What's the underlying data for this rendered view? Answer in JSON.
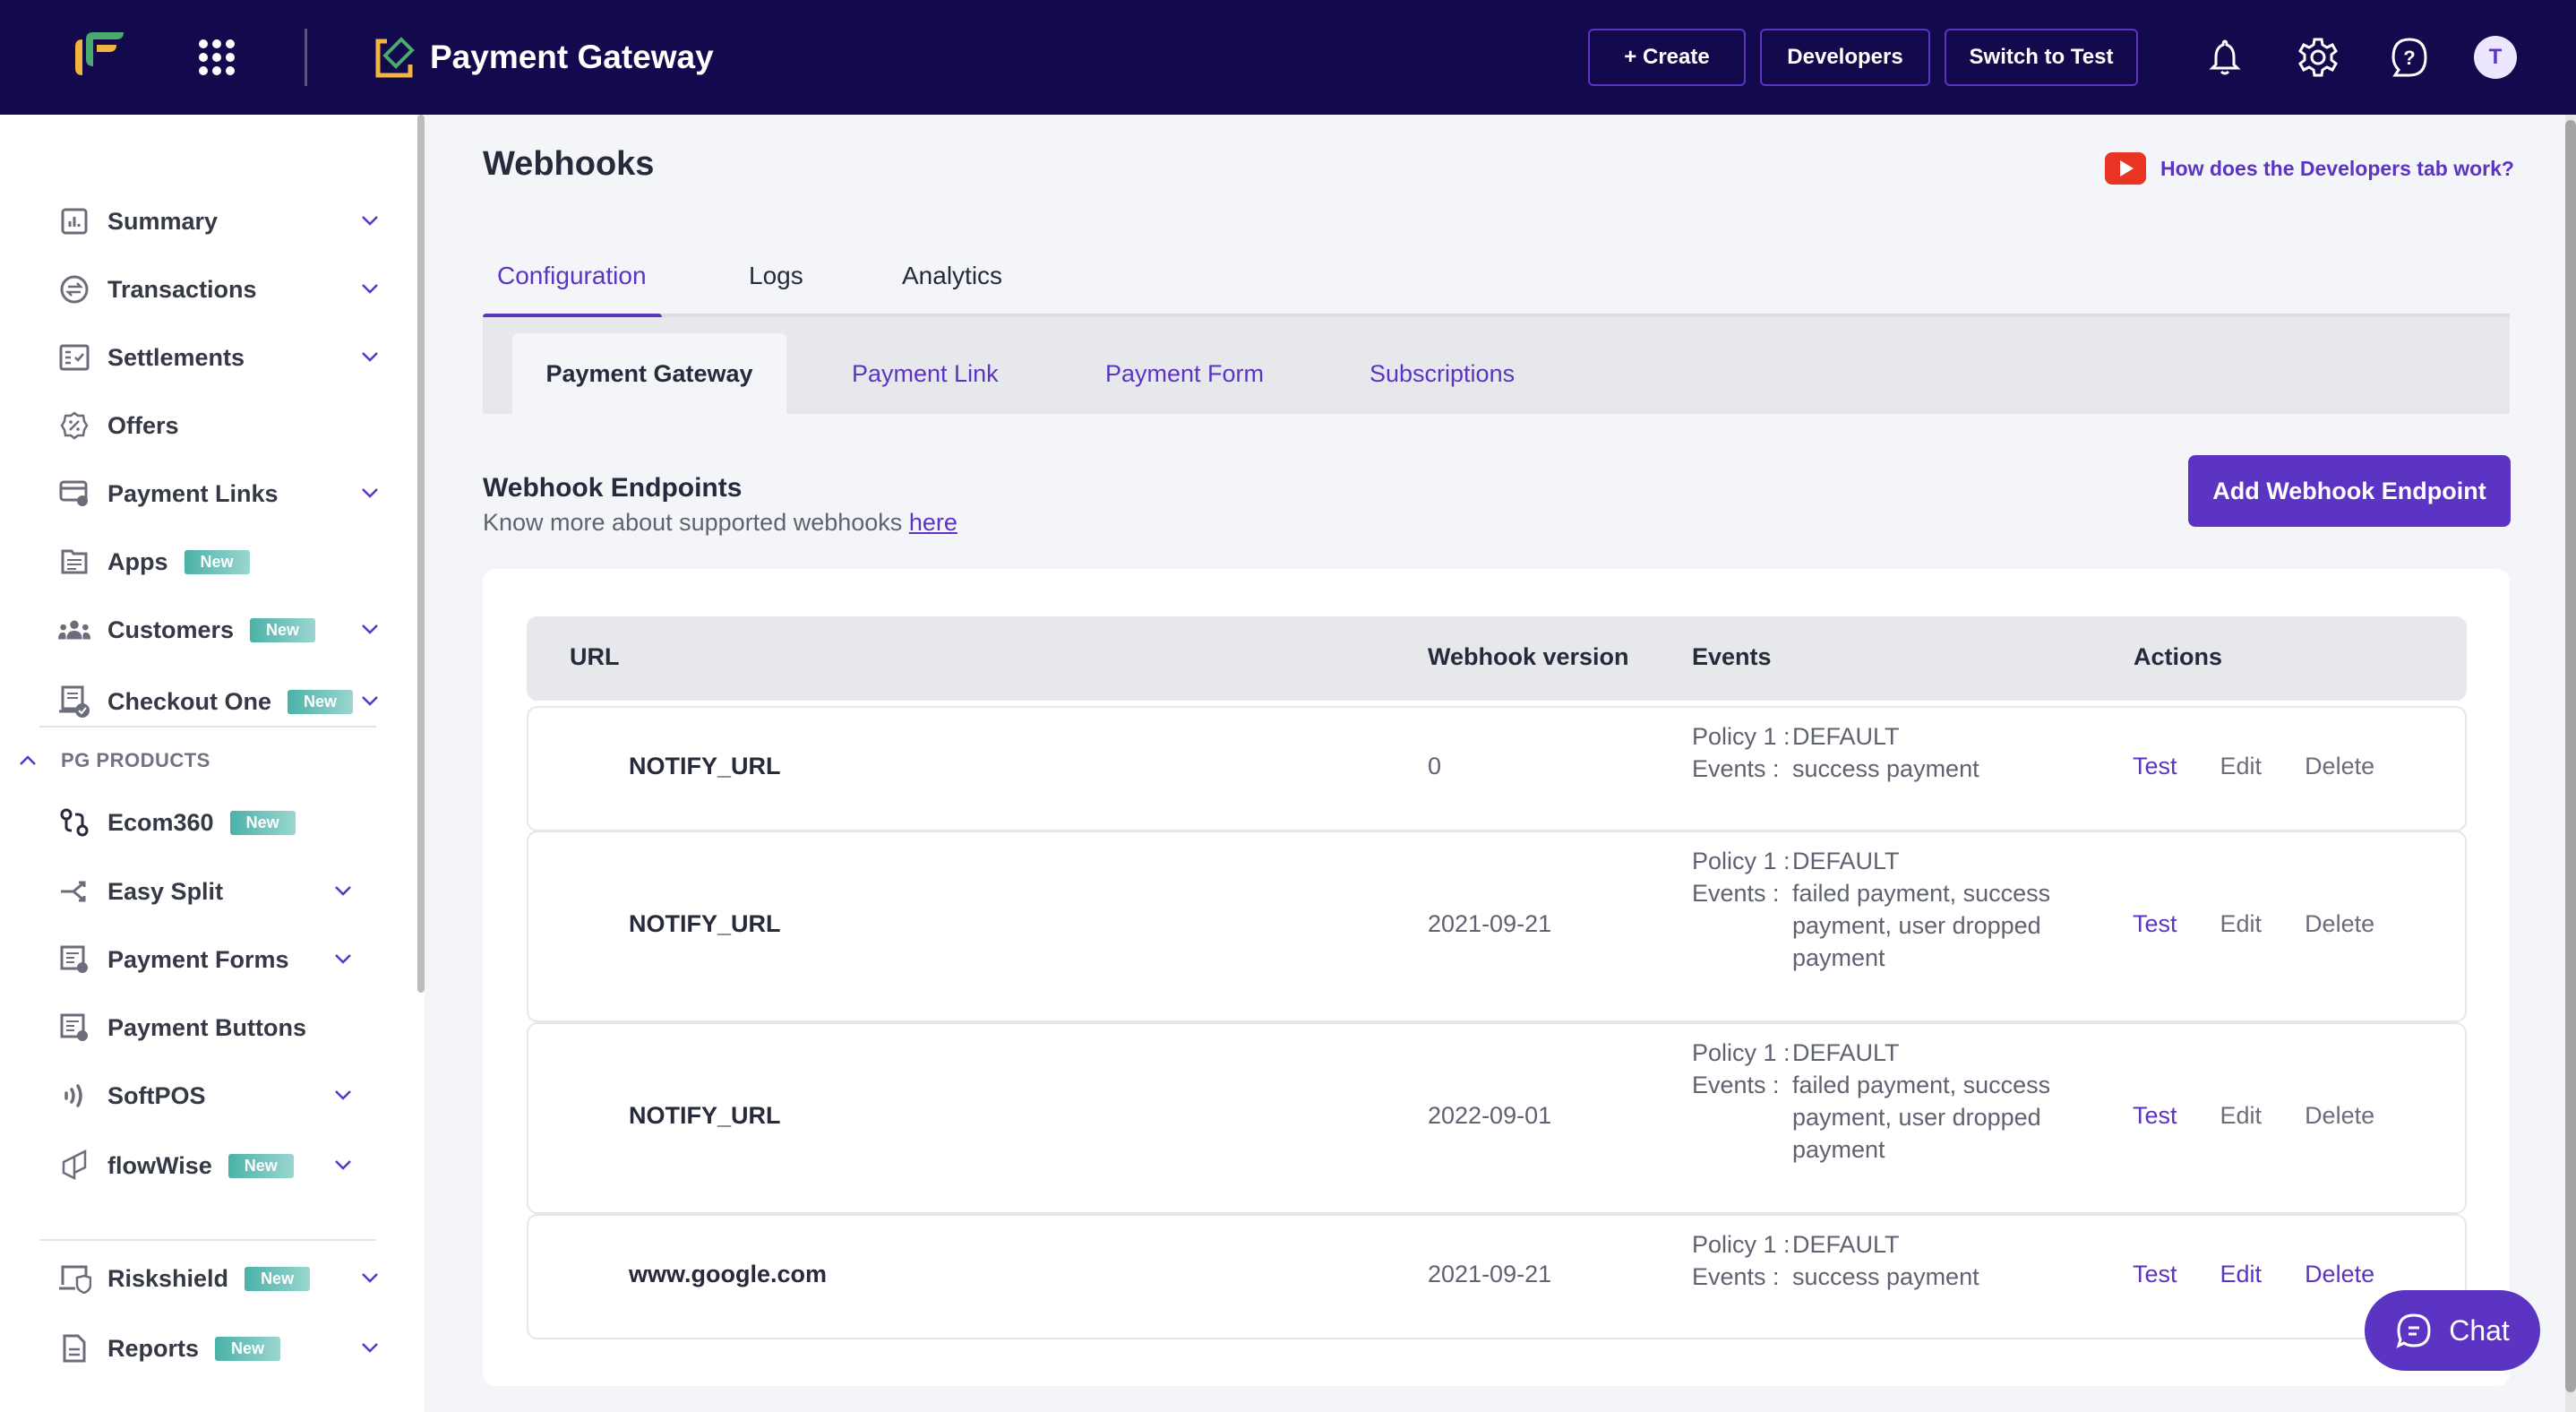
{
  "topbar": {
    "product_title": "Payment Gateway",
    "buttons": {
      "create": "+ Create",
      "developers": "Developers",
      "switch": "Switch to Test"
    },
    "avatar_initial": "T",
    "icons": [
      "fintech-logo-icon",
      "apps-grid-icon",
      "payment-gateway-icon",
      "bell-icon",
      "gear-icon",
      "help-icon"
    ]
  },
  "sidebar": {
    "items": [
      {
        "label": "Summary",
        "icon": "bar-chart-icon",
        "badge": null,
        "chevron": true
      },
      {
        "label": "Transactions",
        "icon": "exchange-icon",
        "badge": null,
        "chevron": true
      },
      {
        "label": "Settlements",
        "icon": "checklist-icon",
        "badge": null,
        "chevron": true
      },
      {
        "label": "Offers",
        "icon": "discount-icon",
        "badge": null,
        "chevron": false
      },
      {
        "label": "Payment Links",
        "icon": "card-link-icon",
        "badge": null,
        "chevron": true
      },
      {
        "label": "Apps",
        "icon": "folder-icon",
        "badge": "New",
        "chevron": false
      },
      {
        "label": "Customers",
        "icon": "users-icon",
        "badge": "New",
        "chevron": true
      },
      {
        "label": "Checkout One",
        "icon": "checkout-icon",
        "badge": "New",
        "chevron": true
      }
    ],
    "section": {
      "label": "PG PRODUCTS",
      "items": [
        {
          "label": "Ecom360",
          "icon": "flow-icon",
          "badge": "New",
          "chevron": false
        },
        {
          "label": "Easy Split",
          "icon": "split-icon",
          "badge": null,
          "chevron": true
        },
        {
          "label": "Payment Forms",
          "icon": "form-icon",
          "badge": null,
          "chevron": true
        },
        {
          "label": "Payment Buttons",
          "icon": "button-form-icon",
          "badge": null,
          "chevron": false
        },
        {
          "label": "SoftPOS",
          "icon": "contactless-icon",
          "badge": null,
          "chevron": true
        },
        {
          "label": "flowWise",
          "icon": "cube-icon",
          "badge": "New",
          "chevron": true
        }
      ]
    },
    "bottom_items": [
      {
        "label": "Riskshield",
        "icon": "shield-laptop-icon",
        "badge": "New",
        "chevron": true
      },
      {
        "label": "Reports",
        "icon": "report-icon",
        "badge": "New",
        "chevron": true
      }
    ]
  },
  "main": {
    "title": "Webhooks",
    "help_link": "How does the Developers tab work?",
    "tabs": [
      {
        "label": "Configuration",
        "active": true
      },
      {
        "label": "Logs",
        "active": false
      },
      {
        "label": "Analytics",
        "active": false
      }
    ],
    "subtabs": [
      {
        "label": "Payment Gateway",
        "active": true
      },
      {
        "label": "Payment Link",
        "active": false
      },
      {
        "label": "Payment Form",
        "active": false
      },
      {
        "label": "Subscriptions",
        "active": false
      }
    ],
    "endpoints": {
      "title": "Webhook Endpoints",
      "subtitle": "Know more about supported webhooks",
      "subtitle_link": "here",
      "add_button": "Add Webhook Endpoint"
    },
    "table": {
      "columns": [
        "URL",
        "Webhook version",
        "Events",
        "Actions"
      ],
      "policy_label": "Policy 1 :",
      "events_label": "Events :",
      "actions": [
        "Test",
        "Edit",
        "Delete"
      ],
      "rows": [
        {
          "url": "NOTIFY_URL",
          "version": "0",
          "policy": "DEFAULT",
          "events": "success payment"
        },
        {
          "url": "NOTIFY_URL",
          "version": "2021-09-21",
          "policy": "DEFAULT",
          "events": "failed payment, success payment, user dropped payment"
        },
        {
          "url": "NOTIFY_URL",
          "version": "2022-09-01",
          "policy": "DEFAULT",
          "events": "failed payment, success payment, user dropped payment"
        },
        {
          "url": "www.google.com",
          "version": "2021-09-21",
          "policy": "DEFAULT",
          "events": "success payment"
        }
      ]
    }
  },
  "chat": {
    "label": "Chat"
  },
  "colors": {
    "topbar": "#130a4d",
    "accent": "#5b34c4",
    "badge": "#4ab2a8",
    "youtube": "#e93424"
  }
}
